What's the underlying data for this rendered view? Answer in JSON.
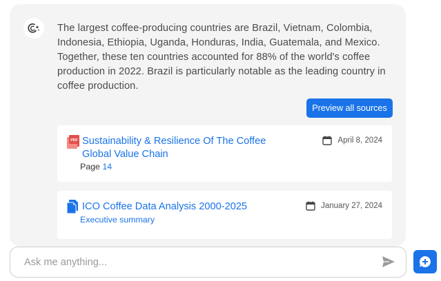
{
  "answer": {
    "text": "The largest coffee-producing countries are Brazil, Vietnam, Colombia, Indonesia, Ethiopia, Uganda, Honduras, India, Guatemala, and Mexico. Together, these ten countries accounted for 88% of the world's coffee production in 2022. Brazil is particularly notable as the leading country in coffee production."
  },
  "preview_button": {
    "label": "Preview all sources"
  },
  "sources": [
    {
      "title": "Sustainability & Resilience Of The Coffee Global Value Chain",
      "date": "April 8, 2024",
      "page_label": "Page",
      "page_number": "14",
      "icon": "pdf-file-icon"
    },
    {
      "title": "ICO Coffee Data Analysis 2000-2025",
      "date": "January 27, 2024",
      "subtitle": "Executive summary",
      "icon": "document-icon"
    }
  ],
  "input": {
    "placeholder": "Ask me anything..."
  },
  "colors": {
    "accent": "#1a73e8",
    "panel": "#f4f4f4",
    "pdf_red": "#e2504c"
  }
}
